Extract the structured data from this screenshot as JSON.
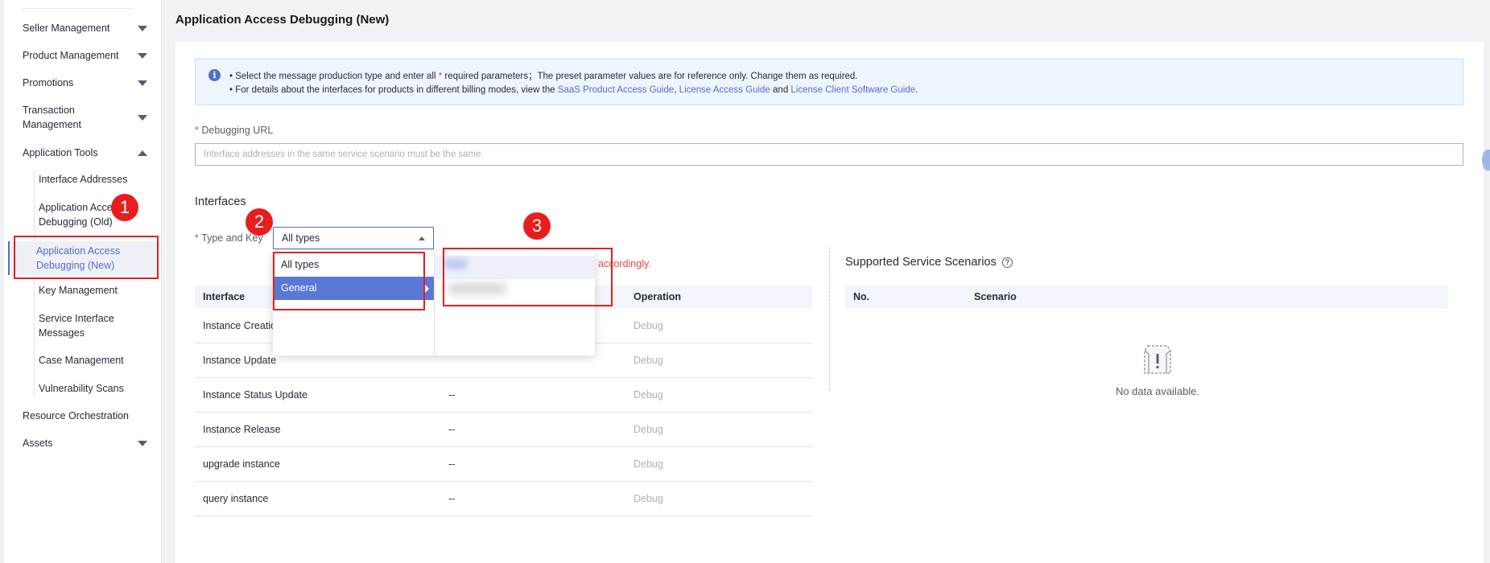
{
  "sidebar": {
    "items": [
      {
        "label": "Seller Management"
      },
      {
        "label": "Product Management"
      },
      {
        "label": "Promotions"
      },
      {
        "label": "Transaction Management"
      },
      {
        "label": "Application Tools"
      },
      {
        "label": "Resource Orchestration"
      },
      {
        "label": "Assets"
      }
    ],
    "sub_items": [
      {
        "label": "Interface Addresses"
      },
      {
        "label": "Application Access Debugging (Old)"
      },
      {
        "label": "Application Access Debugging (New)"
      },
      {
        "label": "Key Management"
      },
      {
        "label": "Service Interface Messages"
      },
      {
        "label": "Case Management"
      },
      {
        "label": "Vulnerability Scans"
      }
    ]
  },
  "page": {
    "title": "Application Access Debugging (New)"
  },
  "info": {
    "icon": "info-icon",
    "line1_a": "• Select the message production type and enter all ",
    "line1_req": "*",
    "line1_b": " required parameters；The preset parameter values are for reference only. Change them as required.",
    "line2_a": "• For details about the interfaces for products in different billing modes, view the ",
    "link1": "SaaS Product Access Guide",
    "sep1": ", ",
    "link2": "License Access Guide",
    "sep2": " and ",
    "link3": "License Client Software Guide",
    "end": "."
  },
  "debug_url": {
    "label": "Debugging URL",
    "req": "*",
    "placeholder": "Interface addresses in the same service scenario must be the same."
  },
  "interfaces": {
    "title": "Interfaces",
    "type_label": "Type and Key",
    "req": "*",
    "select_value": "All types",
    "hint": "accordingly.",
    "headers": [
      "Interface",
      "",
      "Operation"
    ],
    "rows": [
      {
        "name": "Instance Creation",
        "mid": "",
        "op": "Debug"
      },
      {
        "name": "Instance Update",
        "mid": "",
        "op": "Debug"
      },
      {
        "name": "Instance Status Update",
        "mid": "--",
        "op": "Debug"
      },
      {
        "name": "Instance Release",
        "mid": "--",
        "op": "Debug"
      },
      {
        "name": "upgrade instance",
        "mid": "--",
        "op": "Debug"
      },
      {
        "name": "query instance",
        "mid": "--",
        "op": "Debug"
      }
    ]
  },
  "dropdown": {
    "options": [
      "All types",
      "General"
    ],
    "selected": "General"
  },
  "scenarios": {
    "title": "Supported Service Scenarios",
    "help_icon": "question-circle-icon",
    "headers": [
      "No.",
      "Scenario"
    ],
    "empty_text": "No data available."
  },
  "annotations": {
    "badge1": "1",
    "badge2": "2",
    "badge3": "3",
    "color": "#e02020"
  },
  "colors": {
    "accent": "#526ecc",
    "required": "#e54545",
    "selected_option": "#5a78d6"
  }
}
